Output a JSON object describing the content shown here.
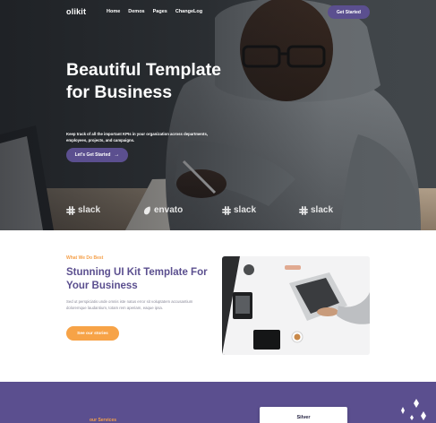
{
  "brand": {
    "name": "olikit"
  },
  "nav": {
    "links": [
      "Home",
      "Demos",
      "Pages",
      "ChangeLog"
    ],
    "cta": "Get Started"
  },
  "hero": {
    "title": "Beautiful Template for Business",
    "subtitle": "Keep track of all the important KPIs in your organization across departments, employees, projects, and campaigns.",
    "cta": "Let's Get Started",
    "cta_icon": "arrow-right-icon"
  },
  "logos": [
    {
      "name": "slack",
      "icon": "slack-logo"
    },
    {
      "name": "envato",
      "icon": "envato-leaf"
    },
    {
      "name": "slack",
      "icon": "slack-logo"
    },
    {
      "name": "slack",
      "icon": "slack-logo"
    }
  ],
  "what_we_do": {
    "kicker": "What We Do Best",
    "title": "Stunning UI Kit Template For Your Business",
    "text": "Sed ut perspiciatis unde omnis iste natus error sit voluptatem accusantium doloremque laudantium, totam rem aperiam, eaque ipsa.",
    "cta": "See our stories"
  },
  "services": {
    "kicker": "our Services"
  },
  "pricing": {
    "card_title": "Silver"
  },
  "colors": {
    "primary": "#5b4f8f",
    "accent": "#f7a347",
    "dark": "#1f1d3d"
  }
}
